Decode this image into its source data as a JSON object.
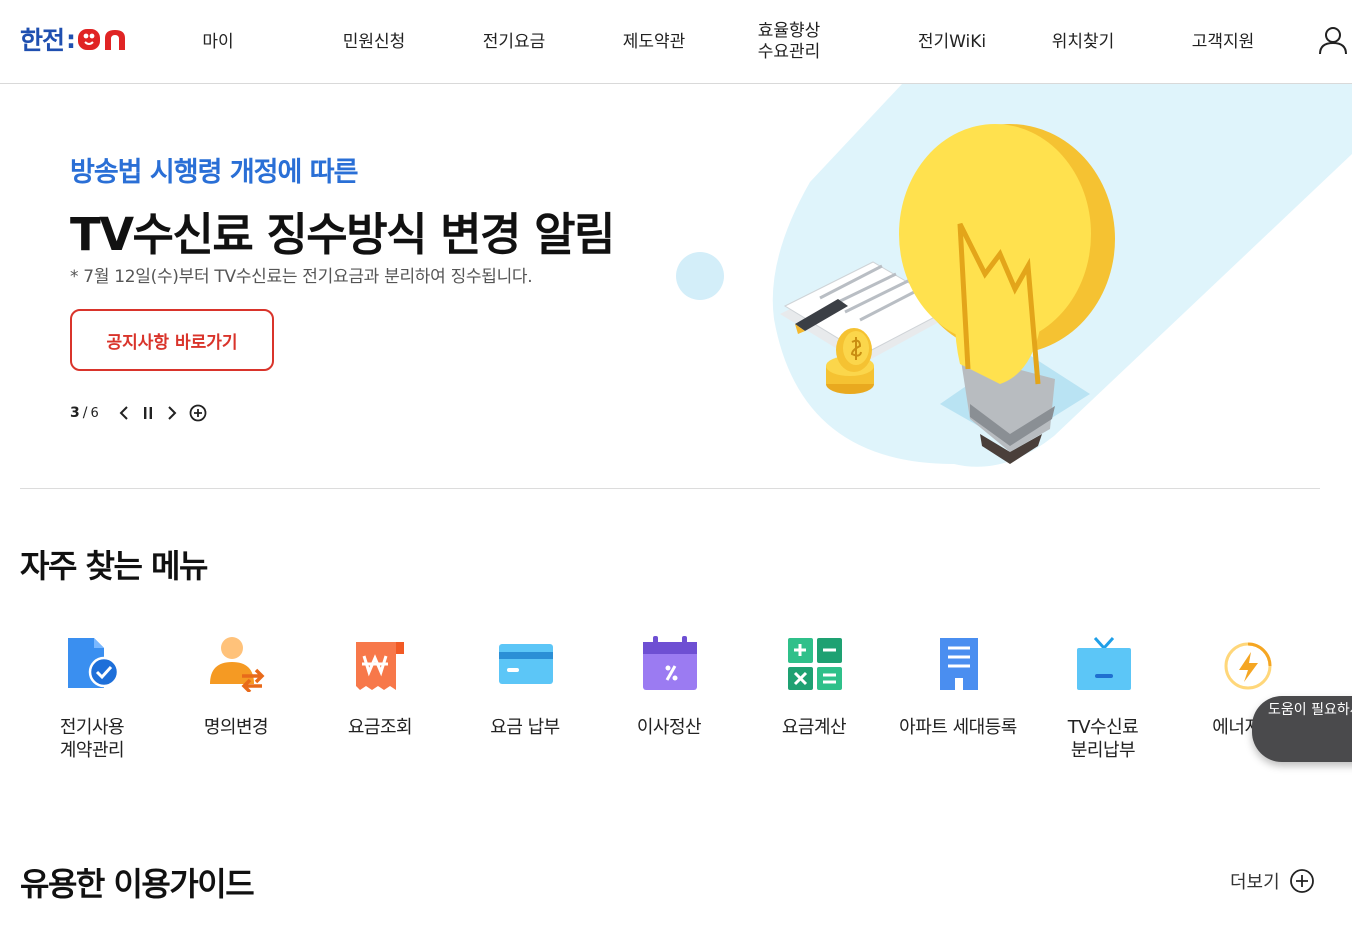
{
  "header": {
    "logo_ko": "한전",
    "logo_colon": ":",
    "logo_on": "ON",
    "nav": [
      {
        "label": "마이"
      },
      {
        "label": "민원신청"
      },
      {
        "label": "전기요금"
      },
      {
        "label": "제도약관"
      },
      {
        "label": "효율향상\n수요관리"
      },
      {
        "label": "전기WiKi"
      },
      {
        "label": "위치찾기"
      },
      {
        "label": "고객지원"
      }
    ],
    "user_icon": "user-icon"
  },
  "hero": {
    "subtitle": "방송법 시행령 개정에 따른",
    "title": "TV수신료 징수방식 변경 알림",
    "note": "* 7월 12일(수)부터 TV수신료는 전기요금과 분리하여 징수됩니다.",
    "button": "공지사항 바로가기",
    "slide_current": "3",
    "slide_separator": "/",
    "slide_total": "6",
    "accent_color": "#2a6fd6",
    "button_color": "#d9342b"
  },
  "quick_menu": {
    "title": "자주 찾는 메뉴",
    "items": [
      {
        "label": "전기사용\n계약관리",
        "icon": "document-check-icon"
      },
      {
        "label": "명의변경",
        "icon": "person-transfer-icon"
      },
      {
        "label": "요금조회",
        "icon": "won-receipt-icon"
      },
      {
        "label": "요금 납부",
        "icon": "credit-card-icon"
      },
      {
        "label": "이사정산",
        "icon": "calendar-percent-icon"
      },
      {
        "label": "요금계산",
        "icon": "calculator-icon"
      },
      {
        "label": "아파트 세대등록",
        "icon": "apartment-icon"
      },
      {
        "label": "TV수신료\n분리납부",
        "icon": "tv-icon"
      },
      {
        "label": "에너지 효",
        "icon": "energy-bolt-icon"
      }
    ]
  },
  "help": {
    "label": "도움이 필요하세요?"
  },
  "guide": {
    "title": "유용한 이용가이드",
    "more": "더보기"
  }
}
